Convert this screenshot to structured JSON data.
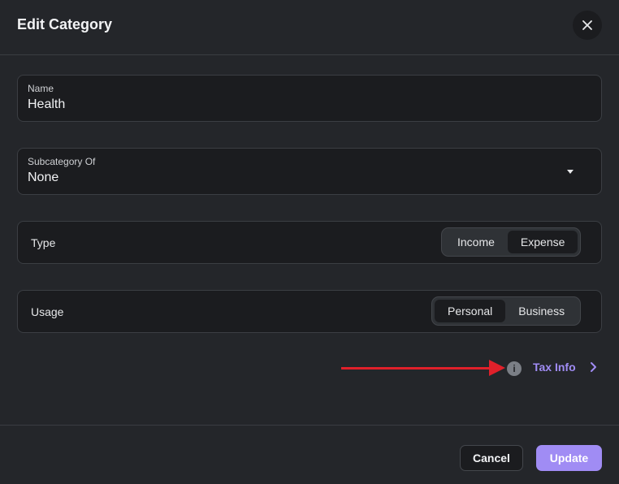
{
  "dialog": {
    "title": "Edit Category",
    "close_icon": "close-icon"
  },
  "name_field": {
    "label": "Name",
    "value": "Health"
  },
  "subcategory_field": {
    "label": "Subcategory Of",
    "value": "None",
    "icon": "caret-down-icon"
  },
  "type_row": {
    "label": "Type",
    "options": [
      "Income",
      "Expense"
    ],
    "selected": "Expense"
  },
  "usage_row": {
    "label": "Usage",
    "options": [
      "Personal",
      "Business"
    ],
    "selected": "Personal"
  },
  "tax_info": {
    "label": "Tax Info",
    "info_icon": "info-icon",
    "chevron_icon": "chevron-right-icon"
  },
  "footer": {
    "cancel_label": "Cancel",
    "update_label": "Update"
  },
  "colors": {
    "accent": "#a08cf4",
    "annotation_arrow": "#e0202a",
    "background": "#24262a",
    "field_background": "#1b1c1f"
  }
}
